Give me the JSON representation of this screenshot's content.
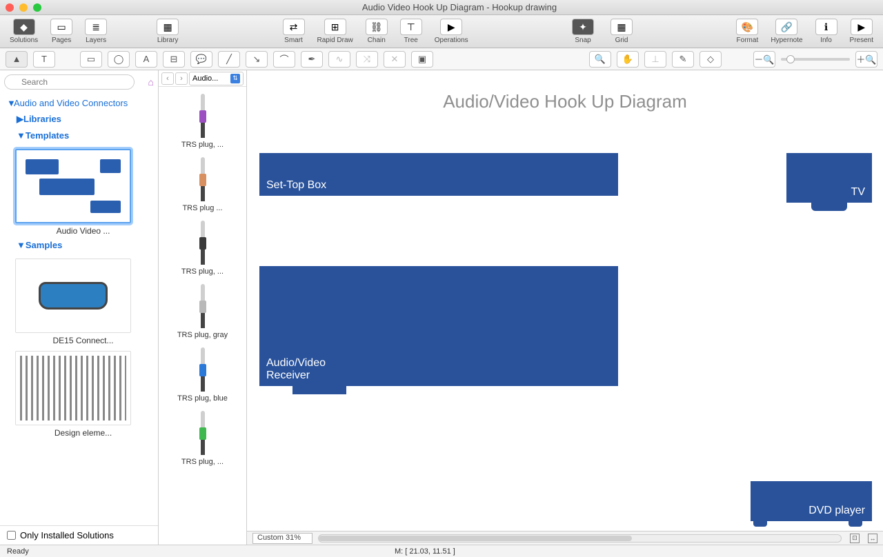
{
  "title": "Audio Video Hook Up Diagram - Hookup drawing",
  "toolbar": {
    "left": [
      {
        "label": "Solutions",
        "icon": "◆"
      },
      {
        "label": "Pages",
        "icon": "▭"
      },
      {
        "label": "Layers",
        "icon": "≣"
      }
    ],
    "library": {
      "label": "Library",
      "icon": "▦"
    },
    "mid": [
      {
        "label": "Smart",
        "icon": "⇄"
      },
      {
        "label": "Rapid Draw",
        "icon": "⊞"
      },
      {
        "label": "Chain",
        "icon": "⛓"
      },
      {
        "label": "Tree",
        "icon": "⊤"
      },
      {
        "label": "Operations",
        "icon": "▶"
      }
    ],
    "snap": {
      "label": "Snap",
      "icon": "✦"
    },
    "grid": {
      "label": "Grid",
      "icon": "▦"
    },
    "right": [
      {
        "label": "Format",
        "icon": "🎨"
      },
      {
        "label": "Hypernote",
        "icon": "🔗"
      },
      {
        "label": "Info",
        "icon": "ℹ"
      },
      {
        "label": "Present",
        "icon": "▶"
      }
    ]
  },
  "search_placeholder": "Search",
  "tree": {
    "root": "Audio and Video Connectors",
    "libraries": "Libraries",
    "templates": "Templates",
    "tpl1": "Audio Video ...",
    "samples": "Samples",
    "s1": "DE15 Connect...",
    "s2": "Design eleme..."
  },
  "only_installed": "Only Installed Solutions",
  "stencil": {
    "dropdown": "Audio...",
    "items": [
      {
        "label": "TRS plug, ...",
        "color": "#9b4fc1"
      },
      {
        "label": "TRS plug ...",
        "color": "#d89060"
      },
      {
        "label": "TRS plug, ...",
        "color": "#3a3a3a"
      },
      {
        "label": "TRS plug, gray",
        "color": "#b9b9b9"
      },
      {
        "label": "TRS plug, blue",
        "color": "#2a78d8"
      },
      {
        "label": "TRS plug, ...",
        "color": "#3fb84f"
      }
    ]
  },
  "canvas": {
    "title": "Audio/Video Hook Up Diagram",
    "shapes": {
      "stb": "Set-Top Box",
      "tv": "TV",
      "receiver": "Audio/Video\nReceiver",
      "dvd": "DVD player"
    },
    "zoom": "Custom 31%"
  },
  "status": {
    "ready": "Ready",
    "mouse": "M: [ 21.03, 11.51 ]"
  }
}
